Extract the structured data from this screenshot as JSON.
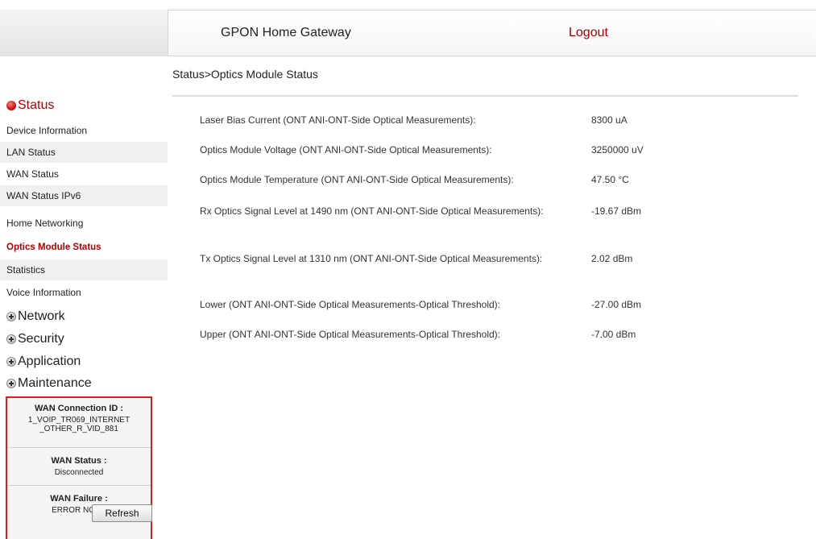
{
  "header": {
    "title": "GPON Home Gateway",
    "logout_label": "Logout"
  },
  "breadcrumb": "Status>Optics Module Status",
  "sidebar": {
    "status_label": "Status",
    "items": [
      {
        "label": "Device Information"
      },
      {
        "label": "LAN Status"
      },
      {
        "label": "WAN Status"
      },
      {
        "label": "WAN Status IPv6"
      },
      {
        "label": "Home Networking"
      },
      {
        "label": "Optics Module Status"
      },
      {
        "label": "Statistics"
      },
      {
        "label": "Voice Information"
      }
    ],
    "groups": [
      {
        "label": "Network"
      },
      {
        "label": "Security"
      },
      {
        "label": "Application"
      },
      {
        "label": "Maintenance"
      }
    ]
  },
  "wan_box": {
    "conn_id_label": "WAN Connection ID :",
    "conn_id_line1": "1_VOIP_TR069_INTERNET",
    "conn_id_line2": "_OTHER_R_VID_881",
    "status_label": "WAN Status :",
    "status_value": "Disconnected",
    "failure_label": "WAN Failure :",
    "failure_value": "ERROR NONE",
    "refresh_label": "Refresh"
  },
  "measurements": [
    {
      "label": "Laser Bias Current (ONT ANI-ONT-Side Optical Measurements):",
      "value": "8300 uA"
    },
    {
      "label": "Optics Module Voltage (ONT ANI-ONT-Side Optical Measurements):",
      "value": "3250000 uV"
    },
    {
      "label": "Optics Module Temperature (ONT ANI-ONT-Side Optical Measurements):",
      "value": "47.50 °C"
    },
    {
      "label": "Rx Optics Signal Level at 1490 nm (ONT ANI-ONT-Side Optical Measurements):",
      "value": "-19.67 dBm"
    },
    {
      "label": "Tx Optics Signal Level at 1310 nm (ONT ANI-ONT-Side Optical Measurements):",
      "value": "2.02 dBm"
    },
    {
      "label": "Lower (ONT ANI-ONT-Side Optical Measurements-Optical Threshold):",
      "value": "-27.00 dBm"
    },
    {
      "label": "Upper (ONT ANI-ONT-Side Optical Measurements-Optical Threshold):",
      "value": "-7.00 dBm"
    }
  ],
  "colors": {
    "accent": "#b30000",
    "wan_box_border": "#d62020"
  }
}
